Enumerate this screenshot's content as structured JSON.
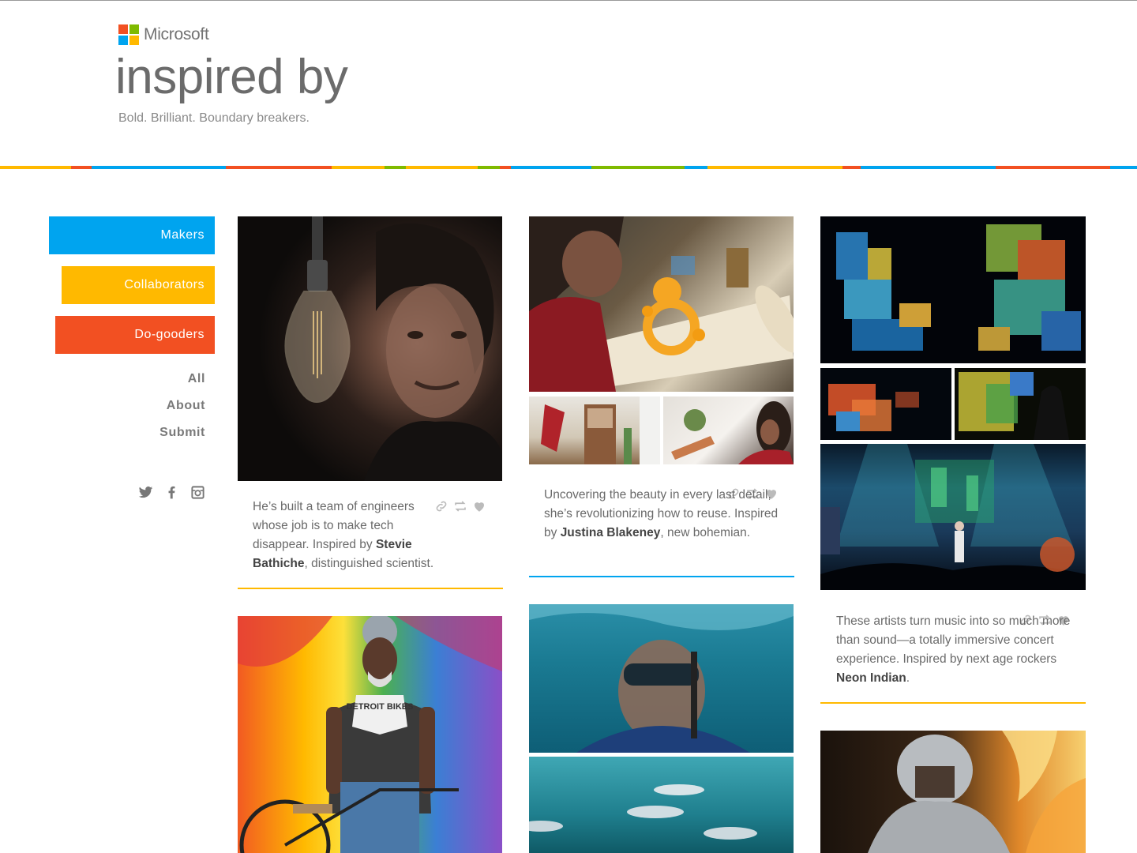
{
  "brand": {
    "wordmark": "Microsoft",
    "logo_colors": [
      "#f25022",
      "#7fba00",
      "#00a4ef",
      "#ffb900"
    ]
  },
  "header": {
    "title": "inspired by",
    "tagline": "Bold. Brilliant. Boundary breakers."
  },
  "colorbar": [
    "#ffb900",
    "#f25022",
    "#00a4ef",
    "#f25022",
    "#ffb900",
    "#7fba00",
    "#ffb900",
    "#7fba00",
    "#f25022",
    "#00a4ef",
    "#7fba00",
    "#00a4ef",
    "#ffb900",
    "#f25022",
    "#00a4ef",
    "#f25022",
    "#00a4ef"
  ],
  "sidebar": {
    "categories": [
      {
        "label": "Makers",
        "color": "#00a4ef"
      },
      {
        "label": "Collaborators",
        "color": "#ffb900"
      },
      {
        "label": "Do-gooders",
        "color": "#f25022"
      }
    ],
    "links": [
      "All",
      "About",
      "Submit"
    ],
    "social_icons": [
      "twitter-icon",
      "facebook-icon",
      "instagram-icon"
    ]
  },
  "cards": [
    {
      "caption_pre": "He’s built a team of engineers whose job is to make tech disappear. Inspired by ",
      "person": "Stevie Bathiche",
      "caption_post": ", distinguished scientist.",
      "accent": "#ffb900"
    },
    {
      "caption_pre": "Uncovering the beauty in every last detail, she’s revolutionizing how to reuse. Inspired by ",
      "person": "Justina Blakeney",
      "caption_post": ", new bohemian.",
      "accent": "#00a4ef"
    },
    {
      "caption_pre": "These artists turn music into so much more than sound—a totally immersive concert experience. Inspired by next age rockers ",
      "person": "Neon Indian",
      "caption_post": ".",
      "accent": "#ffb900"
    }
  ],
  "photo_overlays": {
    "shirt_text": "DETROIT BIKES"
  },
  "action_icons": [
    "link-icon",
    "repost-icon",
    "heart-icon"
  ]
}
